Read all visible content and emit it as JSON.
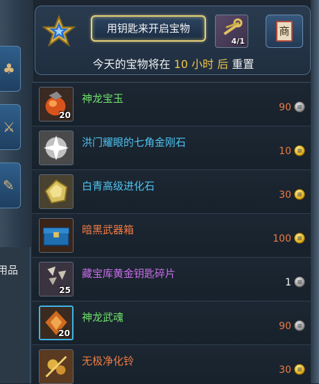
{
  "header": {
    "open_button_label": "用钥匙来开启宝物",
    "key_count": "4/1",
    "shop_icon_glyph": "商",
    "reset_prefix": "今天的宝物将在",
    "reset_hours": "10 小时 后",
    "reset_suffix": "重置"
  },
  "side": {
    "strip_text": "用品"
  },
  "items": [
    {
      "name": "神龙宝玉",
      "name_color": "#6fe06a",
      "quantity": "20",
      "price": "90",
      "currency": "silver",
      "price_color": "#f07a42",
      "icon": "orange-gem-icon"
    },
    {
      "name": "洪门耀眼的七角金刚石",
      "name_color": "#4fc3f0",
      "quantity": "",
      "price": "10",
      "currency": "gold",
      "price_color": "#f07a42",
      "icon": "diamond-icon"
    },
    {
      "name": "白青高级进化石",
      "name_color": "#4fc3f0",
      "quantity": "",
      "price": "30",
      "currency": "gold",
      "price_color": "#f07a42",
      "icon": "evolution-stone-icon"
    },
    {
      "name": "暗黑武器箱",
      "name_color": "#f07a42",
      "quantity": "",
      "price": "100",
      "currency": "gold",
      "price_color": "#f07a42",
      "icon": "weapon-chest-icon"
    },
    {
      "name": "藏宝库黄金钥匙碎片",
      "name_color": "#c86ee8",
      "quantity": "25",
      "price": "1",
      "currency": "silver",
      "price_color": "#ffffff",
      "icon": "key-fragment-icon"
    },
    {
      "name": "神龙武魂",
      "name_color": "#6fe06a",
      "quantity": "20",
      "price": "90",
      "currency": "silver",
      "price_color": "#f07a42",
      "icon": "dragon-soul-icon"
    },
    {
      "name": "无极净化铃",
      "name_color": "#f07a42",
      "quantity": "",
      "price": "30",
      "currency": "gold",
      "price_color": "#f07a42",
      "icon": "purify-bell-icon"
    }
  ]
}
